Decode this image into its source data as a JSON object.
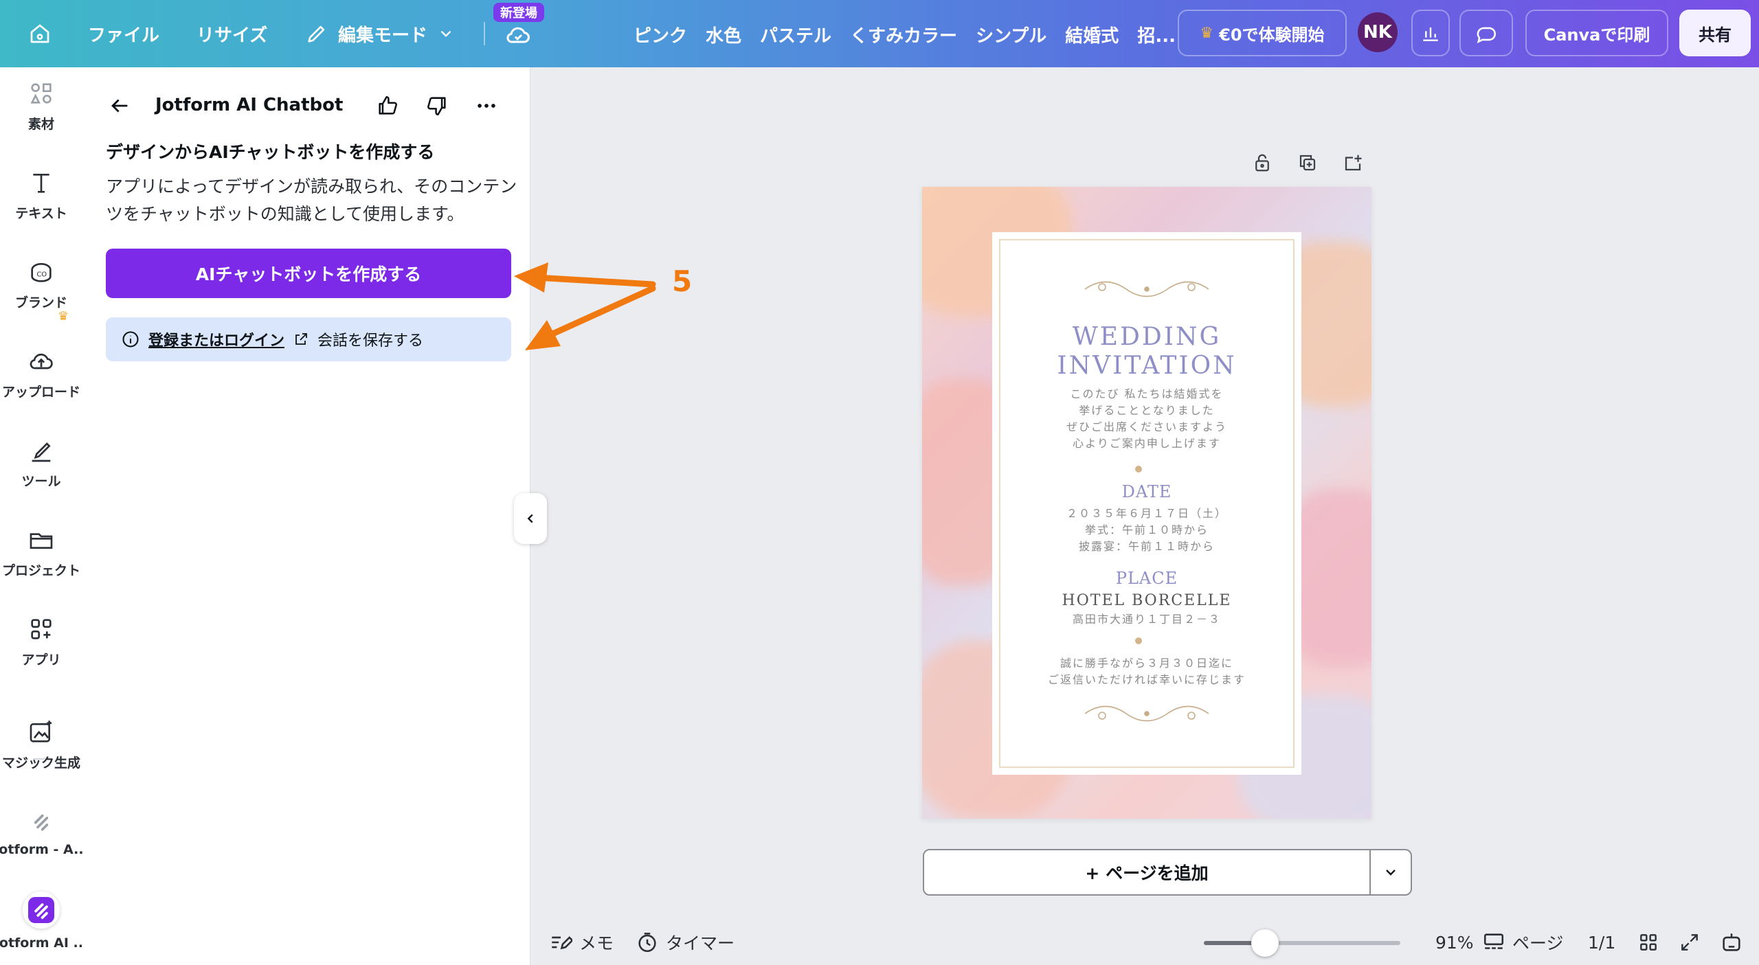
{
  "topbar": {
    "file_label": "ファイル",
    "resize_label": "リサイズ",
    "edit_mode_label": "編集モード",
    "new_badge": "新登場",
    "keywords": [
      "ピンク",
      "水色",
      "パステル",
      "くすみカラー",
      "シンプル",
      "結婚式",
      "招..."
    ],
    "trial_label": "€0で体験開始",
    "avatar_initials": "NK",
    "print_label": "Canvaで印刷",
    "share_label": "共有"
  },
  "rail": {
    "items": [
      {
        "label": "素材",
        "icon": "elements-icon"
      },
      {
        "label": "テキスト",
        "icon": "text-icon"
      },
      {
        "label": "ブランド",
        "icon": "brand-icon"
      },
      {
        "label": "アップロード",
        "icon": "upload-icon"
      },
      {
        "label": "ツール",
        "icon": "draw-icon"
      },
      {
        "label": "プロジェクト",
        "icon": "folder-icon"
      },
      {
        "label": "アプリ",
        "icon": "apps-icon"
      },
      {
        "label": "マジック生成",
        "icon": "magic-media-icon"
      },
      {
        "label": "Jotform - A...",
        "icon": "jotform-icon"
      },
      {
        "label": "Jotform AI ...",
        "icon": "jotform-ai-icon"
      }
    ]
  },
  "panel": {
    "title": "Jotform AI Chatbot",
    "heading": "デザインからAIチャットボットを作成する",
    "description": "アプリによってデザインが読み取られ、そのコンテンツをチャットボットの知識として使用します。",
    "create_button": "AIチャットボットを作成する",
    "login_link": "登録またはログイン",
    "login_suffix": "会話を保存する"
  },
  "annotation": {
    "step_number": "5",
    "color": "#f07a10"
  },
  "invitation": {
    "title_line1": "WEDDING",
    "title_line2": "INVITATION",
    "intro": [
      "このたび 私たちは結婚式を",
      "挙げることとなりました",
      "ぜひご出席くださいますよう",
      "心よりご案内申し上げます"
    ],
    "date_heading": "DATE",
    "date_lines": [
      "２０３５年６月１７日（土）",
      "挙式：午前１０時から",
      "披露宴：午前１１時から"
    ],
    "place_heading": "PLACE",
    "place_name": "HOTEL BORCELLE",
    "place_address": "高田市大通り１丁目２－３",
    "closing": [
      "誠に勝手ながら３月３０日迄に",
      "ご返信いただければ幸いに存じます"
    ]
  },
  "canvas": {
    "add_page_label": "+ ページを追加"
  },
  "bottombar": {
    "notes_label": "メモ",
    "timer_label": "タイマー",
    "zoom_percent": "91%",
    "zoom_value": 0.31,
    "pages_label": "ページ",
    "page_count": "1/1"
  },
  "colors": {
    "accent_purple": "#7d2ae8",
    "info_bg": "#d9e6fb",
    "arrow_orange": "#f07a10"
  }
}
